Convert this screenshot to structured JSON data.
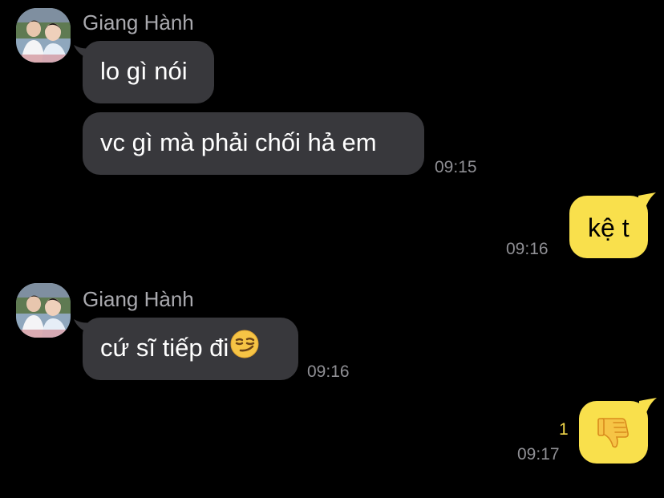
{
  "messages": {
    "group1": {
      "sender": "Giang Hành",
      "bubble1": "lo gì nói",
      "bubble2": "vc gì mà phải chối hả em",
      "time": "09:15"
    },
    "out1": {
      "text": "kệ t",
      "time": "09:16"
    },
    "group2": {
      "sender": "Giang Hành",
      "bubble1": "cứ sĩ tiếp đi",
      "emoji": "smirking-face",
      "time": "09:16"
    },
    "out2": {
      "emoji": "thumbs-down",
      "unread": "1",
      "time": "09:17"
    }
  },
  "colors": {
    "incoming_bubble": "#38383c",
    "outgoing_bubble": "#f9e04c",
    "background": "#000000",
    "timestamp": "#8f8f94",
    "unread_count": "#f4d94a"
  }
}
